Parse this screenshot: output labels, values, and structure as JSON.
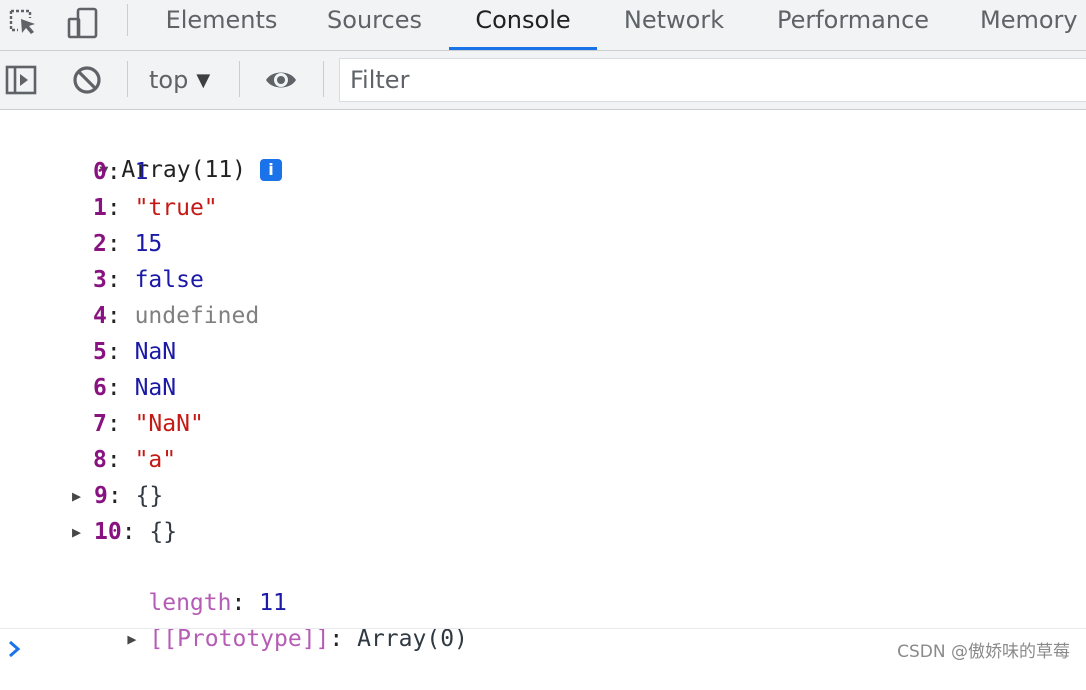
{
  "tabs": [
    {
      "label": "Elements",
      "selected": false
    },
    {
      "label": "Sources",
      "selected": false
    },
    {
      "label": "Console",
      "selected": true
    },
    {
      "label": "Network",
      "selected": false
    },
    {
      "label": "Performance",
      "selected": false
    },
    {
      "label": "Memory",
      "selected": false
    }
  ],
  "toolbar": {
    "context": "top",
    "context_caret": "▼",
    "filter_placeholder": "Filter"
  },
  "console": {
    "header": {
      "expand": "▼",
      "label": "Array(11)",
      "info_badge": "i"
    },
    "entries": [
      {
        "key": "0",
        "value": "1",
        "type": "number"
      },
      {
        "key": "1",
        "value": "\"true\"",
        "type": "string"
      },
      {
        "key": "2",
        "value": "15",
        "type": "number"
      },
      {
        "key": "3",
        "value": "false",
        "type": "boolean"
      },
      {
        "key": "4",
        "value": "undefined",
        "type": "undefined"
      },
      {
        "key": "5",
        "value": "NaN",
        "type": "number"
      },
      {
        "key": "6",
        "value": "NaN",
        "type": "number"
      },
      {
        "key": "7",
        "value": "\"NaN\"",
        "type": "string"
      },
      {
        "key": "8",
        "value": "\"a\"",
        "type": "string"
      },
      {
        "key": "9",
        "value": "{}",
        "type": "object",
        "expandable": true
      },
      {
        "key": "10",
        "value": "{}",
        "type": "object",
        "expandable": true
      }
    ],
    "length": {
      "key": "length",
      "value": "11"
    },
    "prototype": {
      "key": "[[Prototype]]",
      "value": "Array(0)"
    },
    "collapsed_marker": "▶",
    "separator": ": "
  },
  "watermark": "CSDN @傲娇味的草莓",
  "colors": {
    "accent": "#1a73e8",
    "key": "#881280",
    "number": "#1a1aa6",
    "string": "#c41a16",
    "undefined": "#808080"
  },
  "icons": [
    "inspect-element-icon",
    "device-toolbar-icon",
    "sidebar-toggle-icon",
    "clear-console-icon",
    "eye-icon",
    "prompt-chevron-icon"
  ]
}
